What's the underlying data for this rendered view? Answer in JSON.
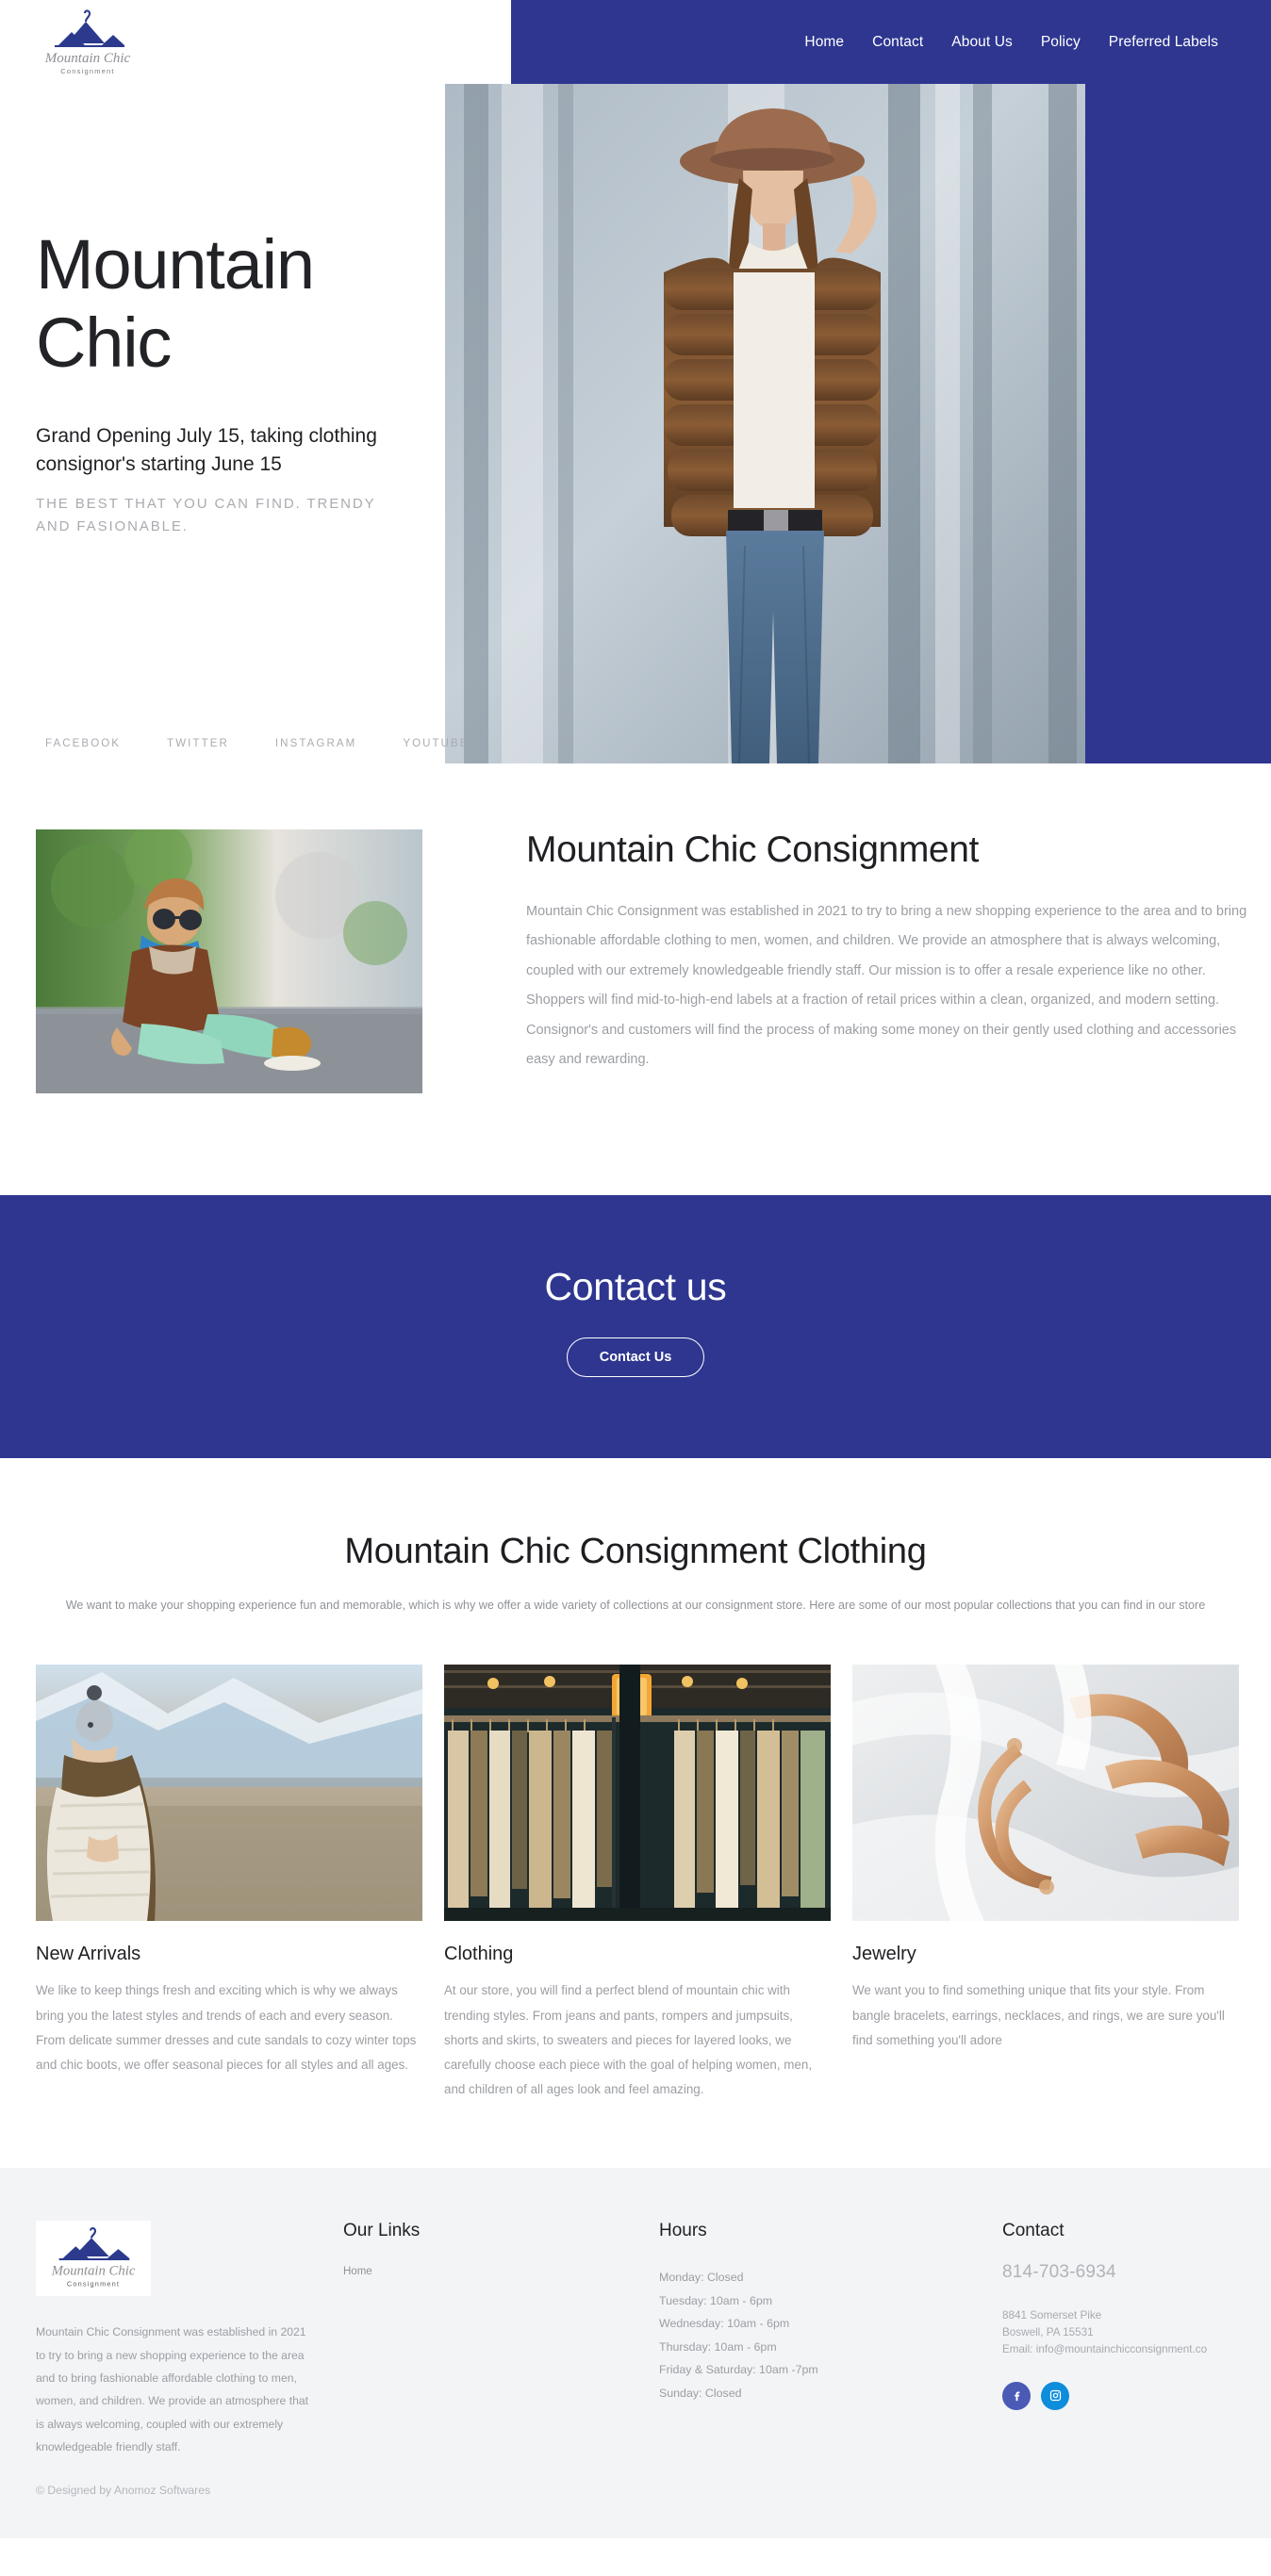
{
  "brand": {
    "name": "Mountain Chic",
    "sub": "Consignment",
    "logo_icon": "mountain-hanger-logo"
  },
  "nav": {
    "items": [
      {
        "label": "Home"
      },
      {
        "label": "Contact"
      },
      {
        "label": "About Us"
      },
      {
        "label": "Policy"
      },
      {
        "label": "Preferred Labels"
      }
    ]
  },
  "hero": {
    "title": "Mountain Chic",
    "subtitle": "Grand Opening July 15, taking clothing consignor's starting June 15",
    "tagline": "THE BEST THAT YOU CAN FIND. TRENDY AND FASIONABLE.",
    "image_alt": "woman-in-fur-coat-and-hat-photo",
    "social": [
      {
        "label": "FACEBOOK"
      },
      {
        "label": "TWITTER"
      },
      {
        "label": "INSTAGRAM"
      },
      {
        "label": "YOUTUBE"
      }
    ]
  },
  "about": {
    "image_alt": "child-in-brown-jacket-sunglasses-photo",
    "heading": "Mountain Chic Consignment",
    "body": "Mountain Chic Consignment was established in 2021 to try to bring a new shopping experience to the area and to bring fashionable affordable clothing to men, women, and children. We provide an atmosphere that is always welcoming, coupled with our extremely knowledgeable friendly staff. Our mission is to offer a resale experience like no other. Shoppers will find mid-to-high-end labels at a fraction of retail prices within a clean, organized, and modern setting. Consignor's and customers will find the process of making some money on their gently used clothing and accessories easy and rewarding."
  },
  "contact_band": {
    "heading": "Contact us",
    "button_label": "Contact Us"
  },
  "collections": {
    "heading": "Mountain Chic Consignment Clothing",
    "subtitle": "We want to make your shopping experience fun and memorable, which is why we offer a wide variety of collections at our consignment store. Here are some of our most popular collections that you can find in our store",
    "cards": [
      {
        "title": "New Arrivals",
        "image_alt": "woman-in-beanie-and-white-knit-sweater-photo",
        "body": "We like to keep things fresh and exciting which is why we always bring you the latest styles and trends of each and every season. From delicate summer dresses and cute sandals to cozy winter tops and chic boots, we offer seasonal pieces for all styles and all ages."
      },
      {
        "title": "Clothing",
        "image_alt": "clothing-rack-in-store-window-photo",
        "body": "At our store, you will find a perfect blend of mountain chic with trending styles. From jeans and pants, rompers and jumpsuits, shorts and skirts, to sweaters and pieces for layered looks, we carefully choose each piece with the goal of helping women, men, and children of all ages look and feel amazing."
      },
      {
        "title": "Jewelry",
        "image_alt": "gold-bangle-bracelets-on-white-fabric-photo",
        "body": "We want you to find something unique that fits your style. From bangle bracelets, earrings, necklaces, and rings, we are sure you'll find something you'll adore"
      }
    ]
  },
  "footer": {
    "about": "Mountain Chic Consignment was established in 2021 to try to bring a new shopping experience to the area and to bring fashionable affordable clothing to men, women, and children. We provide an atmosphere that is always welcoming, coupled with our extremely knowledgeable friendly staff.",
    "copyright": "© Designed by Anomoz Softwares",
    "links": {
      "heading": "Our Links",
      "items": [
        {
          "label": "Home"
        }
      ]
    },
    "hours": {
      "heading": "Hours",
      "items": [
        "Monday: Closed",
        "Tuesday: 10am - 6pm",
        "Wednesday: 10am - 6pm",
        "Thursday: 10am - 6pm",
        "Friday & Saturday: 10am -7pm",
        "Sunday: Closed"
      ]
    },
    "contact": {
      "heading": "Contact",
      "phone": "814-703-6934",
      "address_line1": "8841 Somerset Pike",
      "address_line2": "Boswell, PA 15531",
      "email_line": "Email: info@mountainchicconsignment.co",
      "socials": [
        {
          "name": "facebook-icon",
          "color": "#4a5ab5"
        },
        {
          "name": "instagram-icon",
          "color": "#0d8ddb"
        }
      ]
    }
  },
  "colors": {
    "brand_blue": "#2e3690",
    "footer_bg": "#f3f4f6",
    "muted_text": "#9b9ea3"
  }
}
